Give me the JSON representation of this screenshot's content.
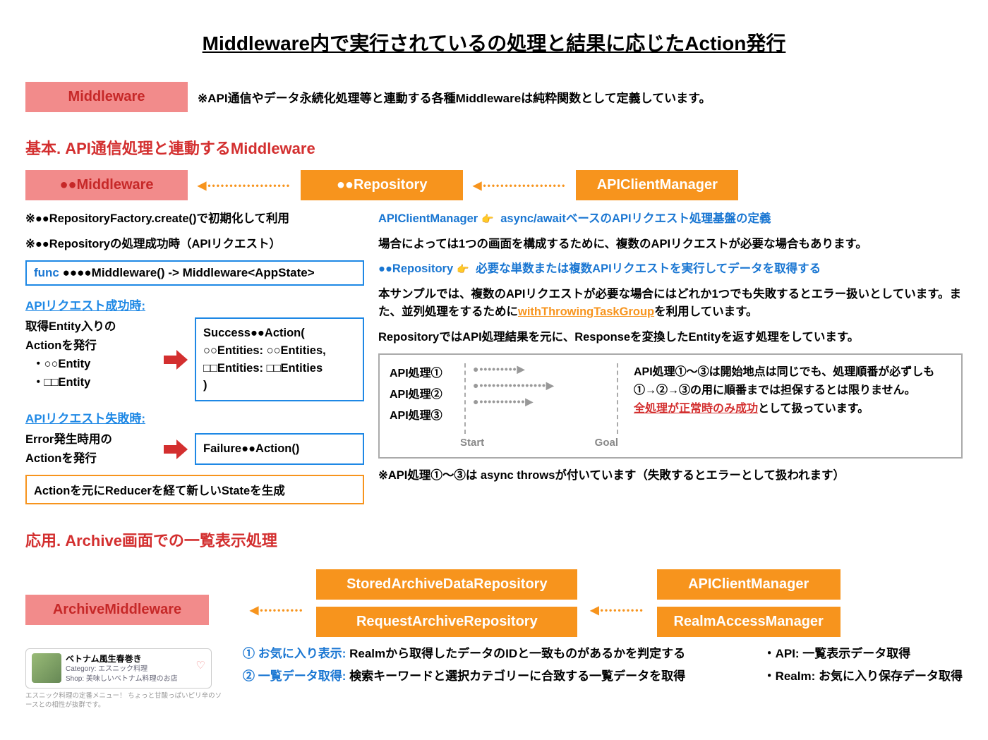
{
  "title": "Middleware内で実行されているの処理と結果に応じたAction発行",
  "header": {
    "middleware_label": "Middleware",
    "middleware_note": "※API通信やデータ永続化処理等と連動する各種Middlewareは純粋関数として定義しています。"
  },
  "section_basic": {
    "heading": "基本. API通信処理と連動するMiddleware",
    "middleware_badge": "●●Middleware",
    "repository_badge": "●●Repository",
    "api_client_badge": "APIClientManager",
    "left": {
      "note1": "※●●RepositoryFactory.create()で初期化して利用",
      "note2": "※●●Repositoryの処理成功時（APIリクエスト）",
      "func_text": "func ●●●●Middleware() -> Middleware<AppState>",
      "success_head": "APIリクエスト成功時:",
      "success_left_l1": "取得Entity入りの",
      "success_left_l2": "Actionを発行",
      "success_left_l3": "・○○Entity",
      "success_left_l4": "・□□Entity",
      "success_code": "Success●●Action(\n    ○○Entities: ○○Entities,\n    □□Entities: □□Entities\n)",
      "failure_head": "APIリクエスト失敗時:",
      "failure_left_l1": "Error発生時用の",
      "failure_left_l2": "Actionを発行",
      "failure_code": "Failure●●Action()",
      "orange_box": "Actionを元にReducerを経て新しいStateを生成"
    },
    "right": {
      "l1_a": "APIClientManager",
      "l1_b": " async/awaitベースのAPIリクエスト処理基盤の定義",
      "l2": "場合によっては1つの画面を構成するために、複数のAPIリクエストが必要な場合もあります。",
      "l3_a": "●●Repository",
      "l3_b": " 必要な単数または複数APIリクエストを実行してデータを取得する",
      "l4": "本サンプルでは、複数のAPIリクエストが必要な場合にはどれか1つでも失敗するとエラー扱いとしています。また、並列処理をするために",
      "l4_link": "withThrowingTaskGroup",
      "l4_b": "を利用しています。",
      "l5": "RepositoryではAPI処理結果を元に、Responseを変換したEntityを返す処理をしています。",
      "api1": "API処理①",
      "api2": "API処理②",
      "api3": "API処理③",
      "start": "Start",
      "goal": "Goal",
      "api_note_l1": "API処理①〜③は開始地点は同じでも、処理順番が必ずしも①→②→③の用に順番までは担保するとは限りません。",
      "api_note_l2": "全処理が正常時のみ成功",
      "api_note_l2b": "として扱っています。",
      "foot": "※API処理①〜③は async throwsが付いています（失敗するとエラーとして扱われます）"
    }
  },
  "section_applied": {
    "heading": "応用. Archive画面での一覧表示処理",
    "archive_middleware": "ArchiveMiddleware",
    "stored_repo": "StoredArchiveDataRepository",
    "request_repo": "RequestArchiveRepository",
    "api_client": "APIClientManager",
    "realm_access": "RealmAccessManager",
    "card": {
      "title": "ベトナム風生春巻き",
      "cat_label": "Category:",
      "cat": "エスニック料理",
      "shop_label": "Shop:",
      "shop": "美味しいベトナム料理のお店",
      "desc": "エスニック料理の定番メニュー！ ちょっと甘酸っぱいピリ辛のソースとの相性が抜群です。"
    },
    "exp1_a": "① お気に入り表示:",
    "exp1_b": "  Realmから取得したデータのIDと一致ものがあるかを判定する",
    "exp2_a": "② 一覧データ取得:",
    "exp2_b": "  検索キーワードと選択カテゴリーに合致する一覧データを取得",
    "right_l1": "・API: 一覧表示データ取得",
    "right_l2": "・Realm: お気に入り保存データ取得"
  }
}
